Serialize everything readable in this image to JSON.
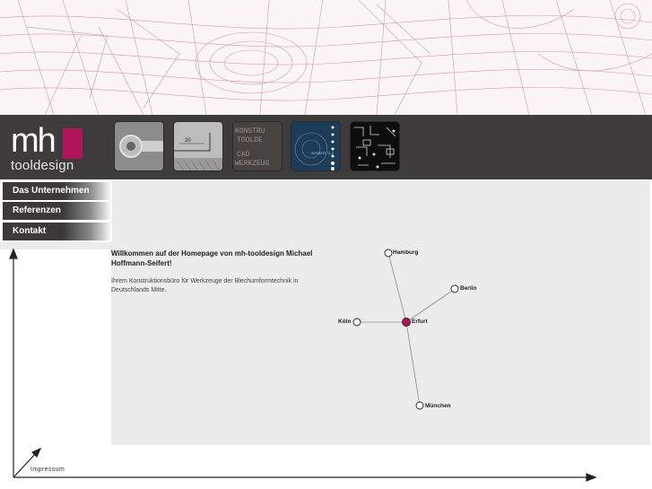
{
  "brand": {
    "logo_mh": "mh",
    "logo_text": "tooldesign",
    "accent": "#b0155a",
    "header_bg": "#3d3b3c"
  },
  "thumbnails": [
    {
      "name": "part-thumbnail",
      "text": ""
    },
    {
      "name": "drawing-thumbnail",
      "text": "20"
    },
    {
      "name": "konstruktion-thumbnail",
      "lines": [
        "KONSTRU",
        "TOOLDE",
        "CAD",
        "WERKZEUG"
      ]
    },
    {
      "name": "signal-thumbnail",
      "text": "SIGNATEC G-G"
    },
    {
      "name": "circuit-thumbnail",
      "text": ""
    }
  ],
  "nav": {
    "items": [
      {
        "label": "Das Unternehmen"
      },
      {
        "label": "Referenzen"
      },
      {
        "label": "Kontakt"
      }
    ]
  },
  "main": {
    "welcome": "Willkommen auf der Homepage von mh-tooldesign Michael Hoffmann-Seifert!",
    "intro": "Ihrem Konstruktionsbüro für Werkzeuge der Blechumformtechnik in Deutschlands Mitte."
  },
  "map": {
    "center": "Erfurt",
    "cities": [
      "Hamburg",
      "Berlin",
      "Köln",
      "Erfurt",
      "München"
    ]
  },
  "footer": {
    "impressum": "Impressum"
  }
}
